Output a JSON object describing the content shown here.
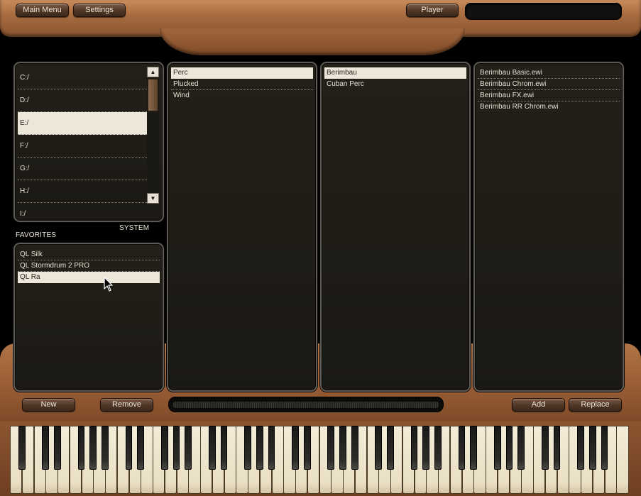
{
  "header": {
    "main_menu_label": "Main Menu",
    "settings_label": "Settings",
    "player_label": "Player"
  },
  "drives": {
    "items": [
      "C:/",
      "D:/",
      "E:/",
      "F:/",
      "G:/",
      "H:/",
      "I:/"
    ],
    "selected": "E:/",
    "system_label": "SYSTEM"
  },
  "favorites": {
    "title": "FAVORITES",
    "items": [
      "QL Silk",
      "QL Stormdrum 2 PRO",
      "QL Ra"
    ],
    "selected": "QL Ra"
  },
  "categories": {
    "items": [
      "Perc",
      "Plucked",
      "Wind"
    ],
    "selected": "Perc"
  },
  "instruments": {
    "items": [
      "Berimbau",
      "Cuban Perc"
    ],
    "selected": "Berimbau"
  },
  "files": {
    "items": [
      "Berimbau Basic.ewi",
      "Berimbau Chrom.ewi",
      "Berimbau FX.ewi",
      "Berimbau RR Chrom.ewi"
    ]
  },
  "footer": {
    "new_label": "New",
    "remove_label": "Remove",
    "add_label": "Add",
    "replace_label": "Replace"
  },
  "icons": {
    "scroll_up": "triangle-up-icon",
    "scroll_down": "triangle-down-icon",
    "pointer": "mouse-pointer-icon"
  },
  "colors": {
    "wood": "#a86c40",
    "panel_bg": "#1d1b16",
    "selection": "#ece7d8"
  }
}
